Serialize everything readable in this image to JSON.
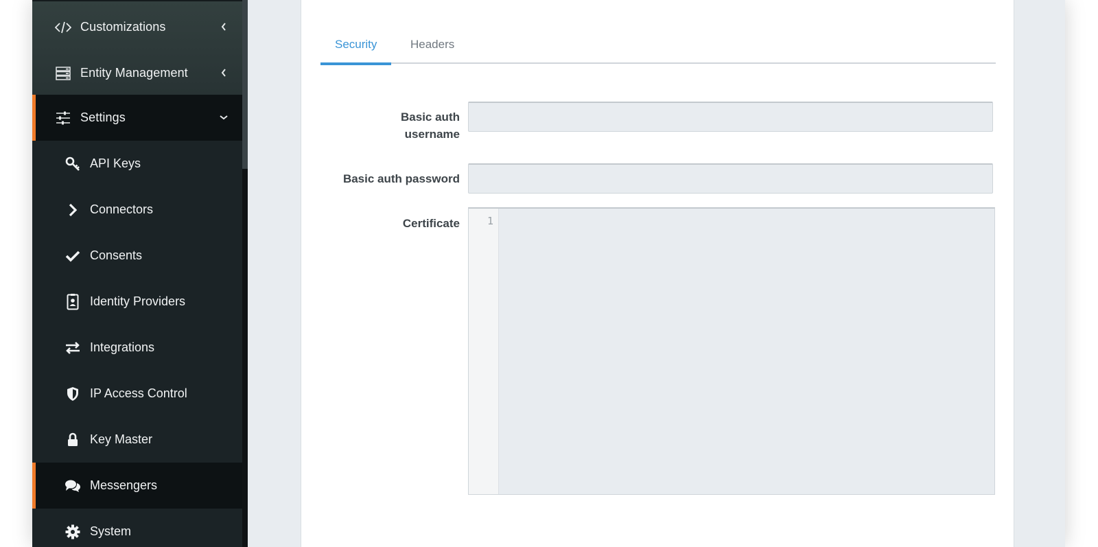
{
  "sidebar": {
    "top_items": [
      {
        "label": "Customizations",
        "icon": "code-icon",
        "expanded": false
      },
      {
        "label": "Entity Management",
        "icon": "server-icon",
        "expanded": false
      }
    ],
    "settings": {
      "label": "Settings",
      "icon": "sliders-icon",
      "expanded": true
    },
    "sub_items": [
      {
        "label": "API Keys",
        "icon": "key-icon"
      },
      {
        "label": "Connectors",
        "icon": "chevron-right-icon"
      },
      {
        "label": "Consents",
        "icon": "check-icon"
      },
      {
        "label": "Identity Providers",
        "icon": "id-badge-icon"
      },
      {
        "label": "Integrations",
        "icon": "exchange-icon"
      },
      {
        "label": "IP Access Control",
        "icon": "shield-icon"
      },
      {
        "label": "Key Master",
        "icon": "lock-icon"
      },
      {
        "label": "Messengers",
        "icon": "chat-icon",
        "active": true
      },
      {
        "label": "System",
        "icon": "cog-icon"
      }
    ]
  },
  "main": {
    "tabs": [
      {
        "label": "Security",
        "active": true
      },
      {
        "label": "Headers",
        "active": false
      }
    ],
    "form": {
      "username_label_line1": "Basic auth",
      "username_label_line2": "username",
      "username_value": "",
      "password_label": "Basic auth password",
      "password_value": "",
      "certificate_label": "Certificate",
      "certificate_line_number": "1"
    }
  },
  "colors": {
    "accent_orange": "#f07a28",
    "tab_blue": "#3a94d6",
    "sidebar_bg": "#1b2326"
  }
}
